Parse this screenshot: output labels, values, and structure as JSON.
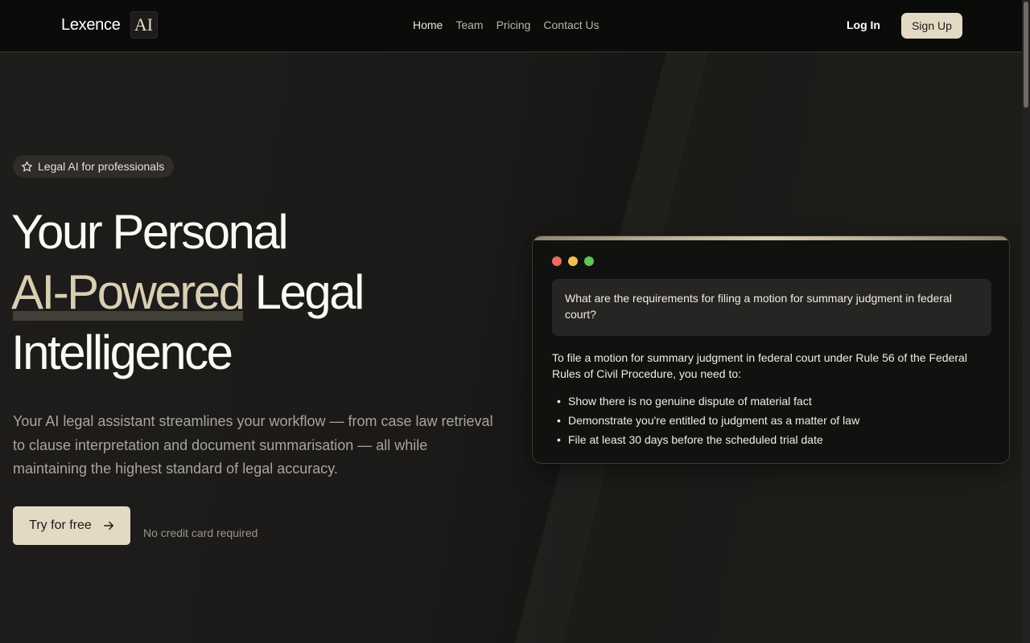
{
  "brand": {
    "name": "Lexence",
    "logo_text": "AI"
  },
  "nav": {
    "links": [
      {
        "label": "Home",
        "active": true
      },
      {
        "label": "Team"
      },
      {
        "label": "Pricing"
      },
      {
        "label": "Contact Us"
      }
    ],
    "login_label": "Log In",
    "signup_label": "Sign Up"
  },
  "hero": {
    "badge": "Legal AI for professionals",
    "badge_icon": "star-icon",
    "headline_line1": "Your Personal",
    "headline_accent": "AI-Powered",
    "headline_line2_rest": "Legal",
    "headline_line3": "Intelligence",
    "subcopy": "Your AI legal assistant streamlines your workflow — from case law retrieval to clause interpretation and document summarisation — all while maintaining the highest standard of legal accuracy.",
    "cta_label": "Try for free",
    "cta_icon": "arrow-right-icon",
    "cta_note": "No credit card required"
  },
  "chat": {
    "window_dots": [
      "#ed6a5e",
      "#f5bf4f",
      "#61c554"
    ],
    "question": "What are the requirements for filing a motion for summary judgment in federal court?",
    "answer_intro": "To file a motion for summary judgment in federal court under Rule 56 of the Federal Rules of Civil Procedure, you need to:",
    "answer_points": [
      "Show there is no genuine dispute of material fact",
      "Demonstrate you're entitled to judgment as a matter of law",
      "File at least 30 days before the scheduled trial date"
    ]
  },
  "colors": {
    "accent": "#e4dac4",
    "background": "#1a1917",
    "navbar": "#0b0b0a"
  }
}
